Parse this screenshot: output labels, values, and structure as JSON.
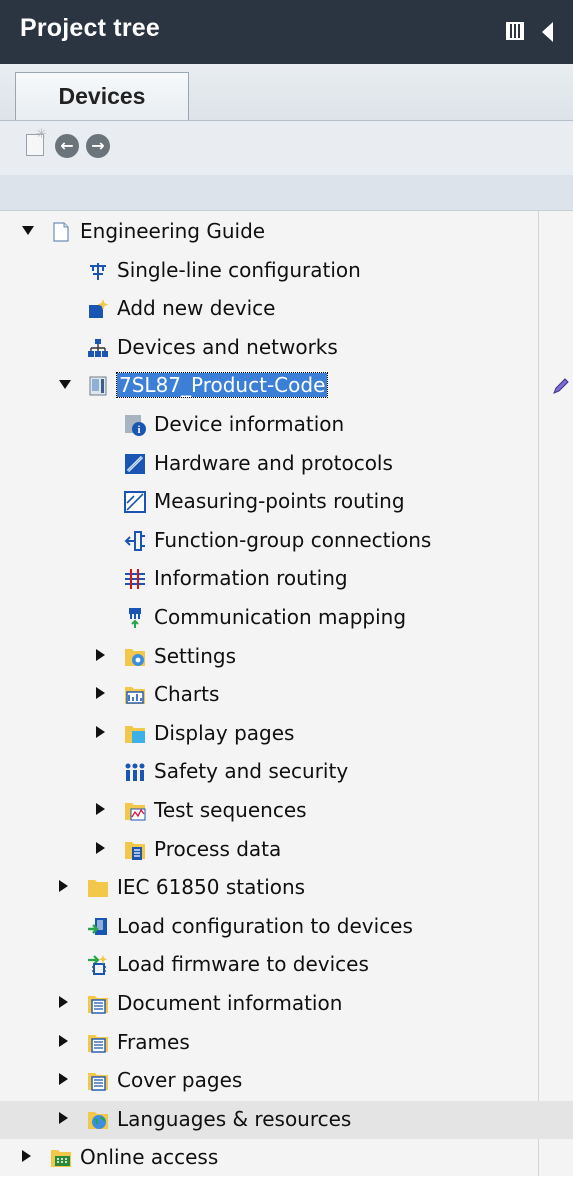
{
  "window": {
    "title": "Project tree"
  },
  "tabs": [
    {
      "label": "Devices"
    }
  ],
  "toolbar": {
    "new_icon": "new-folder-icon",
    "back_icon": "back-arrow-icon",
    "forward_icon": "forward-arrow-icon"
  },
  "tree": {
    "items": [
      {
        "label": "Engineering Guide",
        "icon": "project-icon",
        "expander": "open"
      },
      {
        "label": "Single-line configuration",
        "icon": "single-line-icon",
        "expander": "none"
      },
      {
        "label": "Add new device",
        "icon": "add-device-icon",
        "expander": "none"
      },
      {
        "label": "Devices and networks",
        "icon": "network-icon",
        "expander": "none"
      },
      {
        "label": "7SL87_Product-Code",
        "icon": "device-icon",
        "expander": "open",
        "selected": true
      },
      {
        "label": "Device information",
        "icon": "device-info-icon",
        "expander": "none"
      },
      {
        "label": "Hardware and protocols",
        "icon": "hardware-icon",
        "expander": "none"
      },
      {
        "label": "Measuring-points routing",
        "icon": "measuring-routing-icon",
        "expander": "none"
      },
      {
        "label": "Function-group connections",
        "icon": "function-group-icon",
        "expander": "none"
      },
      {
        "label": "Information routing",
        "icon": "information-routing-icon",
        "expander": "none"
      },
      {
        "label": "Communication mapping",
        "icon": "communication-mapping-icon",
        "expander": "none"
      },
      {
        "label": "Settings",
        "icon": "settings-folder-icon",
        "expander": "closed"
      },
      {
        "label": "Charts",
        "icon": "charts-icon",
        "expander": "closed"
      },
      {
        "label": "Display pages",
        "icon": "display-pages-folder-icon",
        "expander": "closed"
      },
      {
        "label": "Safety and security",
        "icon": "safety-security-icon",
        "expander": "none"
      },
      {
        "label": "Test sequences",
        "icon": "test-sequences-folder-icon",
        "expander": "closed"
      },
      {
        "label": "Process data",
        "icon": "process-data-folder-icon",
        "expander": "closed"
      },
      {
        "label": "IEC 61850 stations",
        "icon": "folder-icon",
        "expander": "closed"
      },
      {
        "label": "Load configuration to devices",
        "icon": "load-configuration-icon",
        "expander": "none"
      },
      {
        "label": "Load firmware to devices",
        "icon": "load-firmware-icon",
        "expander": "none"
      },
      {
        "label": "Document information",
        "icon": "document-folder-icon",
        "expander": "closed"
      },
      {
        "label": "Frames",
        "icon": "frames-folder-icon",
        "expander": "closed"
      },
      {
        "label": "Cover pages",
        "icon": "cover-pages-folder-icon",
        "expander": "closed"
      },
      {
        "label": "Languages & resources",
        "icon": "languages-folder-icon",
        "expander": "closed"
      },
      {
        "label": "Online access",
        "icon": "online-access-folder-icon",
        "expander": "closed"
      }
    ]
  },
  "colors": {
    "titlebar": "#2b3542",
    "selection": "#3b7fd6",
    "folder": "#f2c84b"
  }
}
